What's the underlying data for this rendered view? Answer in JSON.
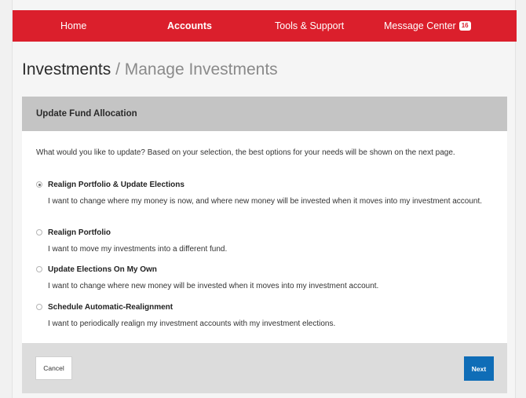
{
  "nav": {
    "items": [
      {
        "label": "Home"
      },
      {
        "label": "Accounts"
      },
      {
        "label": "Tools & Support"
      },
      {
        "label": "Message Center"
      }
    ],
    "active": "Accounts",
    "message_count": "16"
  },
  "page": {
    "title": "Investments",
    "separator": "/",
    "subtitle": "Manage Investments"
  },
  "card": {
    "header": "Update Fund Allocation",
    "intro": "What would you like to update? Based on your selection, the best options for your needs will be shown on the next page.",
    "options": [
      {
        "title": "Realign Portfolio & Update Elections",
        "description": "I want to change where my money is now, and where new money will be invested when it moves into my investment account.",
        "selected": true
      },
      {
        "title": "Realign Portfolio",
        "description": "I want to move my investments into a different fund.",
        "selected": false
      },
      {
        "title": "Update Elections On My Own",
        "description": "I want to change where new money will be invested when it moves into my investment account.",
        "selected": false
      },
      {
        "title": "Schedule Automatic-Realignment",
        "description": "I want to periodically realign my investment accounts with my investment elections.",
        "selected": false
      }
    ]
  },
  "footer": {
    "cancel_label": "Cancel",
    "next_label": "Next"
  },
  "colors": {
    "nav_bg": "#db1f2c",
    "primary_button": "#0f6db7",
    "card_header_bg": "#c4c4c4"
  }
}
